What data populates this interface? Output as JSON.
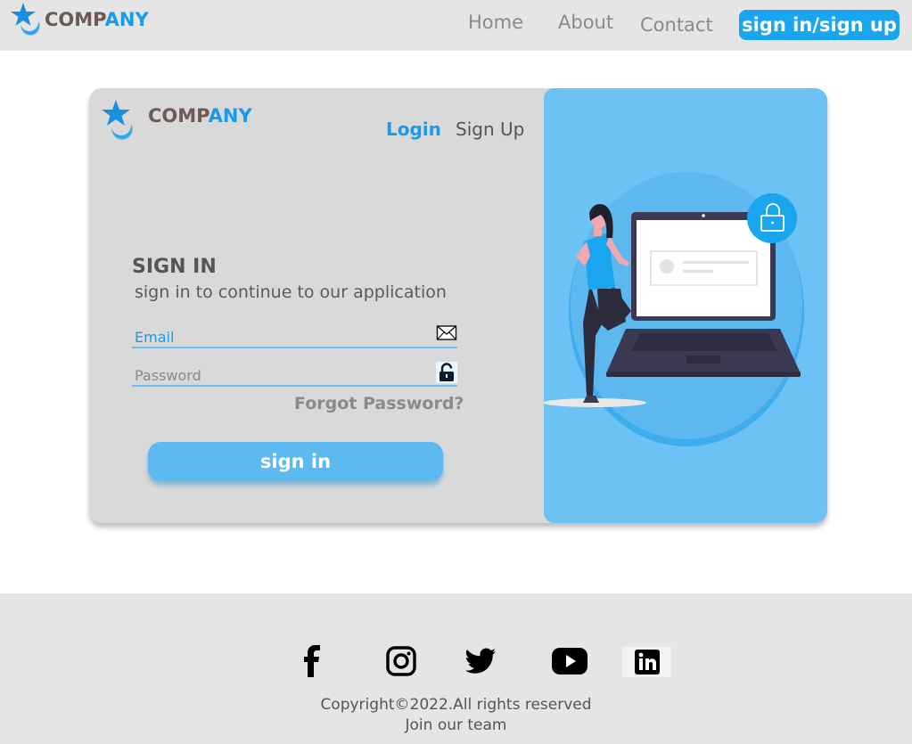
{
  "navbar": {
    "logo": {
      "part1": "COMP",
      "part2": "ANY"
    },
    "links": {
      "home": "Home",
      "about": "About",
      "contact": "Contact"
    },
    "cta_label": "sign in/sign up"
  },
  "card": {
    "logo": {
      "part1": "COMP",
      "part2": "ANY"
    },
    "tabs": {
      "login": "Login",
      "signup": "Sign Up"
    },
    "form": {
      "title": "SIGN IN",
      "subtitle": "sign in to continue to our application",
      "email_placeholder": "Email",
      "password_placeholder": "Password",
      "forgot_label": "Forgot Password?",
      "submit_label": "sign in"
    },
    "illustration_icons": [
      "person-leaning-on-laptop",
      "lock-icon"
    ]
  },
  "footer": {
    "social_icons": [
      "facebook-icon",
      "instagram-icon",
      "twitter-icon",
      "youtube-icon",
      "linkedin-icon"
    ],
    "copyright": "Copyright©2022.All rights reserved",
    "join_label": "Join our team"
  },
  "colors": {
    "accent": "#1a9be8",
    "button": "#5cbaf0",
    "panel": "#6cc2f4",
    "card_bg": "#d9d9d9",
    "bar_bg": "#e5e5e5"
  }
}
